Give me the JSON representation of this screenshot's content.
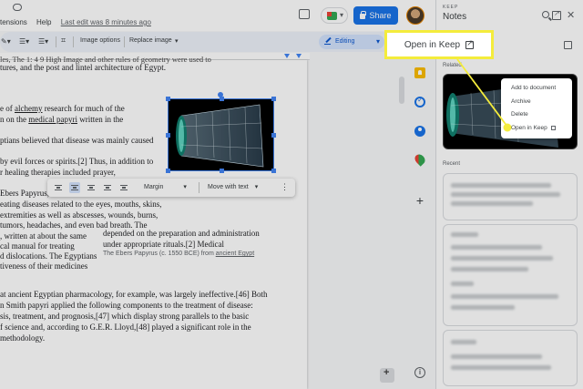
{
  "menu": {
    "extensions": "tensions",
    "help": "Help",
    "last_edit": "Last edit was 8 minutes ago"
  },
  "header": {
    "share_label": "Share"
  },
  "toolbar": {
    "image_options": "Image options",
    "replace_image": "Replace image",
    "replace_caret": "▾",
    "mode": "Editing",
    "mode_caret": "▾"
  },
  "document": {
    "top_line_1": "les, The 1: 4 9 High Image and other rules of geometry were used to",
    "top_line_2": "tures, and the post and lintel architecture of Egypt.",
    "para1": [
      {
        "pre": "e of ",
        "link": "alchemy",
        "post": " research for much of the"
      },
      {
        "pre": "n on the ",
        "link": "medical papyri",
        "post": " written in the"
      }
    ],
    "para2": [
      "ptians believed that disease was mainly caused",
      "by evil forces or spirits.[2] Thus, in addition to",
      "r healing therapies included prayer,"
    ],
    "para3_left": [
      "Ebers Papyrus, w",
      "eating diseases related to the eyes, mouths, skins,",
      "extremities as well as abscesses, wounds, burns,",
      "tumors, headaches, and even bad breath. The",
      ", written at about the same",
      "cal manual for treating",
      "d dislocations. The Egyptians",
      "tiveness of their medicines"
    ],
    "para3_right": [
      "depended on the preparation and administration",
      "under appropriate rituals.[2] Medical"
    ],
    "caption": {
      "text": "The Ebers Papyrus (c. 1550 BCE) from ",
      "link": "ancient Egypt"
    },
    "para4": [
      "at ancient Egyptian pharmacology, for example, was largely ineffective.[46] Both",
      "n Smith papyri applied the following components to the treatment of disease:",
      "sis, treatment, and prognosis,[47] which display strong parallels to the basic",
      "f science and, according to G.E.R. Lloyd,[48] played a significant role in the",
      "methodology."
    ]
  },
  "image_toolbar": {
    "wrap_option": "Margin",
    "wrap_caret": "▾",
    "position_option": "Move with text",
    "position_caret": "▾",
    "more": "⋮"
  },
  "keep": {
    "brand": "KEEP",
    "title": "Notes",
    "close": "✕",
    "related_label": "Related",
    "recent_label": "Recent",
    "context_menu": {
      "add_to_document": "Add to document",
      "archive": "Archive",
      "delete": "Delete",
      "open_in_keep": "Open in Keep"
    }
  },
  "callout": {
    "label": "Open in Keep"
  },
  "rail": {
    "add": "+",
    "info": "i"
  },
  "colors": {
    "share_blue": "#1a73e8",
    "callout_yellow": "#f4ec3c",
    "keep_yellow": "#fbbc04"
  }
}
